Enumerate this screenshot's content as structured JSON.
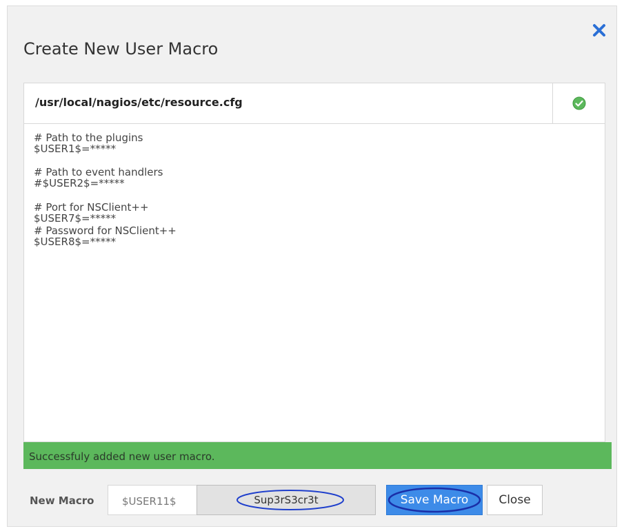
{
  "dialog": {
    "title": "Create New User Macro",
    "close_icon": "close-x-icon"
  },
  "file": {
    "path": "/usr/local/nagios/etc/resource.cfg",
    "status_icon": "check-circle-icon",
    "status_color": "#5cb85c"
  },
  "editor": {
    "lines": [
      "# Path to the plugins",
      "$USER1$=*****",
      "",
      "# Path to event handlers",
      "#$USER2$=*****",
      "",
      "# Port for NSClient++",
      "$USER7$=*****",
      "# Password for NSClient++",
      "$USER8$=*****"
    ]
  },
  "status": {
    "message": "Successfuly added new user macro.",
    "color": "#5cb85c"
  },
  "form": {
    "label": "New Macro",
    "macro_name": "$USER11$",
    "macro_value": "Sup3rS3cr3t",
    "save_label": "Save Macro",
    "close_label": "Close",
    "accent_color": "#3d8be8",
    "annotation_color": "#1f3fcc"
  }
}
